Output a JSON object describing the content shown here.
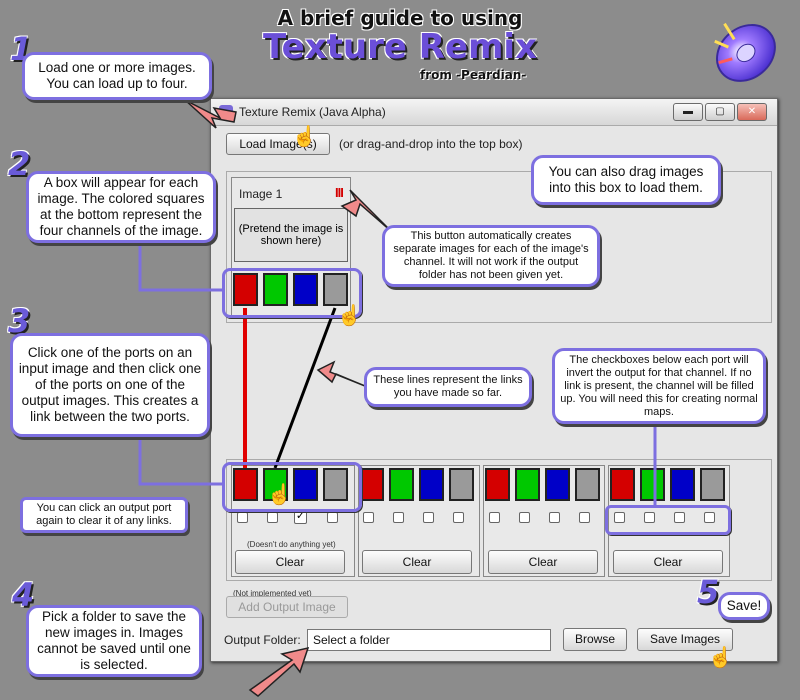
{
  "header": {
    "top_line": "A brief guide to using",
    "app_name": "Texture Remix",
    "byline": "from -Peardian-"
  },
  "steps": {
    "s1": "1",
    "s2": "2",
    "s3": "3",
    "s4": "4",
    "s5": "5"
  },
  "callouts": {
    "c1": "Load one or more images. You can load up to four.",
    "c2": "A box will appear for each image. The colored squares at the bottom represent the four channels of the image.",
    "c3": "Click one of the ports on an input image and then click one of the ports on one of the output images. This creates a link between the two ports.",
    "c3b": "You can click an output port again to clear it of any links.",
    "c4": "Pick a folder to save the new images in. Images cannot be saved until one is selected.",
    "c5": "Save!",
    "drag": "You can also drag images into this box to load them.",
    "split": "This button automatically creates separate images for each of the image's channel. It will not work if the output folder has not been given yet.",
    "lines": "These lines represent the links you have made so far.",
    "checks": "The checkboxes below each port will invert the output for that channel. If no link is present, the channel will be filled up. You will need this for creating normal maps."
  },
  "window": {
    "title": "Texture Remix (Java Alpha)",
    "minimize": "▬",
    "maximize": "▢",
    "close": "✕",
    "load_button": "Load Image(s)",
    "load_hint": "(or drag-and-drop into the top box)",
    "image_title": "Image 1",
    "image_placeholder": "(Pretend the image is shown here)",
    "split_icon": "III",
    "doesnt_do": "(Doesn't do anything yet)",
    "clear_label": "Clear",
    "not_implemented": "(Not implemented yet)",
    "add_output": "Add Output Image",
    "output_folder_label": "Output Folder:",
    "output_folder_value": "Select a folder",
    "browse": "Browse",
    "save": "Save Images"
  },
  "colors": {
    "red": "#d40000",
    "green": "#00c800",
    "blue": "#0000c8",
    "gray": "#9a9a9a",
    "accent": "#7d6fe0",
    "arrow": "#f08a8a"
  }
}
